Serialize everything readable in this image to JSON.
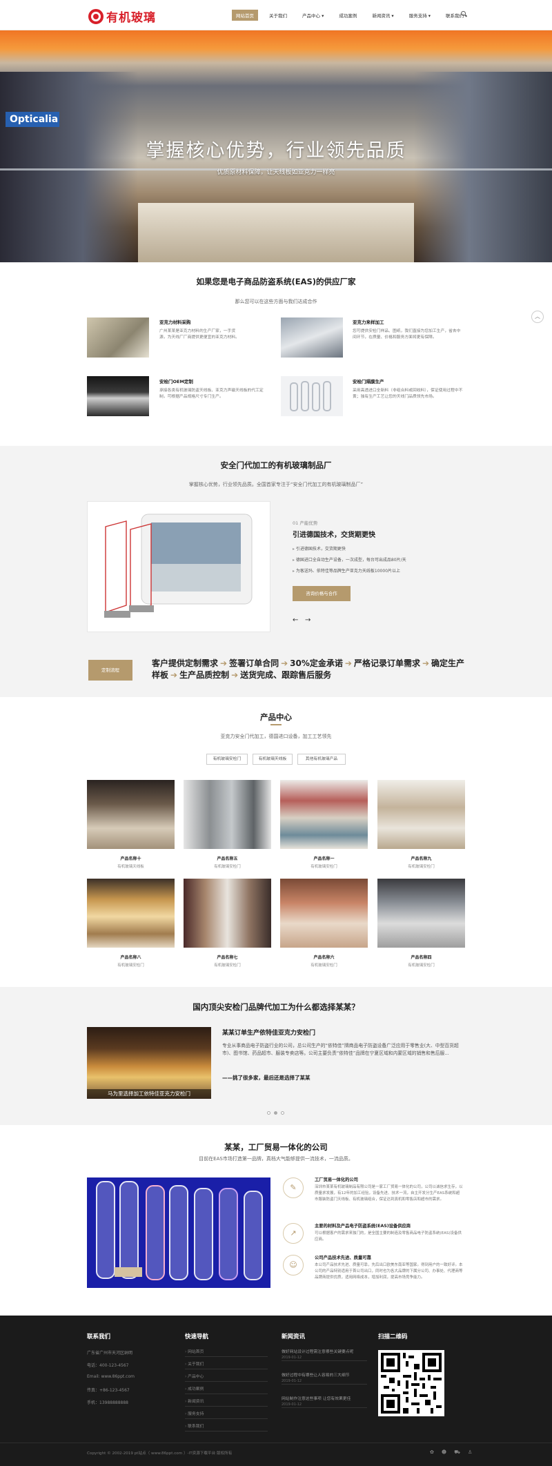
{
  "header": {
    "logo_text": "有机玻璃",
    "nav": [
      "网站首页",
      "关于我们",
      "产品中心",
      "成功案例",
      "新闻资讯",
      "服务支持",
      "联系我们"
    ],
    "nav_dropdowns": [
      false,
      false,
      true,
      false,
      true,
      true,
      false
    ]
  },
  "banner": {
    "sign": "Opticalia",
    "title": "掌握核心优势，行业领先品质",
    "subtitle": "优质原材料保障，让天线板如亚克力一样亮"
  },
  "services": {
    "title": "如果您是电子商品防盗系统(EAS)的供应厂家",
    "subtitle": "那么您可以在这些方面与我们达成合作",
    "items": [
      {
        "title": "亚克力材料采购",
        "desc": "广州某某是亚克力材料的生产厂家，一手货源，为天线厂厂商提供更便宜的亚克力材料。"
      },
      {
        "title": "亚克力来样加工",
        "desc": "您可提供安检门样品、图纸，我们直接为您加工生产，省去中间环节，在质量、价格和服务方面将更有保障。"
      },
      {
        "title": "安检门OEM定制",
        "desc": "承接各类有机玻璃防盗天线板、亚克力声磁天线板的代工定制，可根据产品规格尺寸专门生产。"
      },
      {
        "title": "安检门隔膜生产",
        "desc": "采用高透进口全新料（非组合料或回收料），保证使用过程中不黄；独有生产工艺让您的天线门品质领先市场。"
      }
    ]
  },
  "oem": {
    "title": "安全门代加工的有机玻璃制品厂",
    "subtitle": "掌握核心优势，行业领先品质。全国首家专注于“安全门代加工的有机玻璃制品厂”",
    "num": "01 产能优势",
    "heading": "引进德国技术，交货期更快",
    "points": [
      "引进德国技术，交货期更快",
      "德国进口全自动生产设备，一次成型，每台可出成品80片/天",
      "为客送玛、依特佳等品牌生产亚克力天线板10000片以上"
    ],
    "button": "咨询价格与合作",
    "prev": "←",
    "next": "→",
    "flow_button": "定制流程",
    "flow": [
      "客户提供定制需求",
      "签署订单合同",
      "30%定金承诺",
      "严格记录订单需求",
      "确定生产样板",
      "生产品质控制",
      "送货完成、跟踪售后服务"
    ]
  },
  "products": {
    "title": "产品中心",
    "subtitle": "亚克力安全门代加工，德国进口设备，加工工艺领先",
    "tabs": [
      "有机玻璃安检门",
      "有机玻璃天线板",
      "其他有机玻璃产品"
    ],
    "items": [
      {
        "name": "产品名称十",
        "cat": "有机玻璃天线板"
      },
      {
        "name": "产品名称五",
        "cat": "有机玻璃安检门"
      },
      {
        "name": "产品名称一",
        "cat": "有机玻璃安检门"
      },
      {
        "name": "产品名称九",
        "cat": "有机玻璃安检门"
      },
      {
        "name": "产品名称八",
        "cat": "有机玻璃安检门"
      },
      {
        "name": "产品名称七",
        "cat": "有机玻璃安检门"
      },
      {
        "name": "产品名称六",
        "cat": "有机玻璃安检门"
      },
      {
        "name": "产品名称四",
        "cat": "有机玻璃安检门"
      }
    ]
  },
  "why": {
    "title": "国内顶尖安检门品牌代加工为什么都选择某某？",
    "img_caption": "马为里选择加工依特佳亚克力安检门",
    "heading": "某某订单生产依特佳亚克力安检门",
    "text": "专业从事商品电子防盗行业的公司，总公司生产的“依特佳”牌商品电子防盗设备广泛应用于零售业(大、中型百货超市)、图书馆、药品超市、服装专卖店等。公司主要负责“依特佳”品牌在宁夏区域和内蒙区域的销售和售后服...",
    "quote": "——挑了很多家，最后还是选择了某某"
  },
  "about": {
    "title": "某某，工厂贸易一体化的公司",
    "subtitle": "目前在EAS市场打造第一品牌，真档大气能够提供一流技术，一流品质。",
    "items": [
      {
        "icon": "✎",
        "title": "工厂贸易一体化的公司",
        "desc": "深圳市某某有机玻璃制品有限公司是一家工厂贸易一体化的公司，公司以诚信求生存，以质量求发展，有12年的加工经验，设备先进、技术一流，自主开发分生产EAS系统和超市服装防盗门天线板、有机玻璃组合，保证达到真机和零售店和超市的需求。"
      },
      {
        "icon": "↗",
        "title": "主要的材料及产品电子防盗系统(EAS)设备供应商",
        "desc": "可以根据客户的需求来独门的，是全国主要的制造及零售商品电子防盗系统(EAS)设备供应商。"
      },
      {
        "icon": "☺",
        "title": "公司产品技术先进、质量可靠",
        "desc": "本公司产品技术先进、质量可靠，先后出口欧美东南亚等国家。得到用户的一致好评。本公司的产品特别适用于首公司出口，同时也为各大品牌的下属分公司、办事处、代理商等品牌商提供优质，适用网络成本，增加利润，提高市场竞争能力。"
      }
    ]
  },
  "footer": {
    "contact": {
      "title": "联系我们",
      "lines": [
        "广东省广州市天河区纳明",
        "电话：400-123-4567",
        "Email: www.86ppt.com",
        "传真：+86-123-4567",
        "手机：13988888888"
      ]
    },
    "nav": {
      "title": "快速导航",
      "links": [
        "网站首页",
        "关于我们",
        "产品中心",
        "成功案例",
        "新闻资讯",
        "服务支持",
        "联系我们"
      ]
    },
    "news": {
      "title": "新闻资讯",
      "items": [
        {
          "t": "做好网站设计过程需注意哪些关键要点呢",
          "d": "2019-01-12"
        },
        {
          "t": "做好过程中有哪些让人容易的三大细节",
          "d": "2019-01-12"
        },
        {
          "t": "网站制作注意这些事项 让您有效果更佳",
          "d": "2019-01-12"
        }
      ]
    },
    "qr_title": "扫描二维码",
    "copyright": "Copyright © 2002-2019 pt站点（ www.86ppt.com ）-IT资源下载平台 版权所有",
    "icons": [
      "weibo-icon",
      "qq-icon",
      "cart-icon",
      "user-icon"
    ]
  },
  "colors": {
    "accent": "#b59a6d",
    "logo_red": "#d8202a",
    "footer_bg": "#1b1b1b"
  }
}
